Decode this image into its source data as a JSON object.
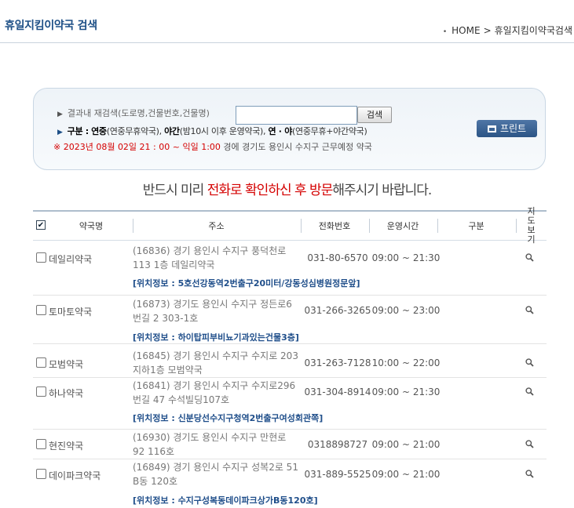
{
  "header": {
    "title": "휴일지킴이약국 검색",
    "breadcrumb_home": "HOME",
    "breadcrumb_sep": ">",
    "breadcrumb_page": "휴일지킴이약국검색"
  },
  "search": {
    "label": "결과내 재검색(도로명,건물번호,건물명)",
    "value": "",
    "button": "검색",
    "legend_head": "구분 :",
    "legend_a": "연중",
    "legend_a_desc": "(연중무휴약국),",
    "legend_b": "야간",
    "legend_b_desc": "(밤10시 이후 운영약국),",
    "legend_c": "연 · 야",
    "legend_c_desc": "(연중무휴+야간약국)",
    "date_text": "※ 2023년 08월 02일 21 : 00 ~ 익일 1:00",
    "date_rest": "경에   경기도  용인시 수지구   근무예정 약국",
    "print_button": "프린트"
  },
  "notice": {
    "pre": "반드시 미리 ",
    "red": "전화로 확인하신 후 방문",
    "post": "해주시기 바랍니다."
  },
  "table": {
    "headers": [
      "약국명",
      "주소",
      "전화번호",
      "운영시간",
      "구분",
      "지도보기"
    ],
    "rows": [
      {
        "name": "데일리약국",
        "addr": "(16836) 경기 용인시 수지구 풍덕천로 113 1층 데일리약국",
        "tel": "031-80-6570",
        "time": "09:00 ~ 21:30",
        "loc": "[위치정보 : 5호선강동역2번출구20미터/강동성심병원정문앞]"
      },
      {
        "name": "토마토약국",
        "addr": "(16873) 경기도 용인시 수지구 정든로6번길 2 303-1호",
        "tel": "031-266-3265",
        "time": "09:00 ~ 23:00",
        "loc": "[위치정보 : 하이탑피부비뇨기과있는건물3층]"
      },
      {
        "name": "모범약국",
        "addr": "(16845) 경기 용인시 수지구 수지로 203 지하1층 모범약국",
        "tel": "031-263-7128",
        "time": "10:00 ~ 22:00",
        "loc": ""
      },
      {
        "name": "하나약국",
        "addr": "(16841) 경기 용인시 수지구 수지로296번길 47 수석빌딩107호",
        "tel": "031-304-8914",
        "time": "09:00 ~ 21:30",
        "loc": "[위치정보 : 신분당선수지구청역2번출구여성회관쪽]"
      },
      {
        "name": "현진약국",
        "addr": "(16930) 경기도 용인시 수지구 만현로 92 116호",
        "tel": "0318898727",
        "time": "09:00 ~ 21:00",
        "loc": ""
      },
      {
        "name": "데이파크약국",
        "addr": "(16849) 경기 용인시 수지구 성복2로 51 B동 120호",
        "tel": "031-889-5525",
        "time": "09:00 ~ 21:00",
        "loc": "[위치정보 : 수지구성복동데이파크상가B동120호]"
      }
    ]
  }
}
